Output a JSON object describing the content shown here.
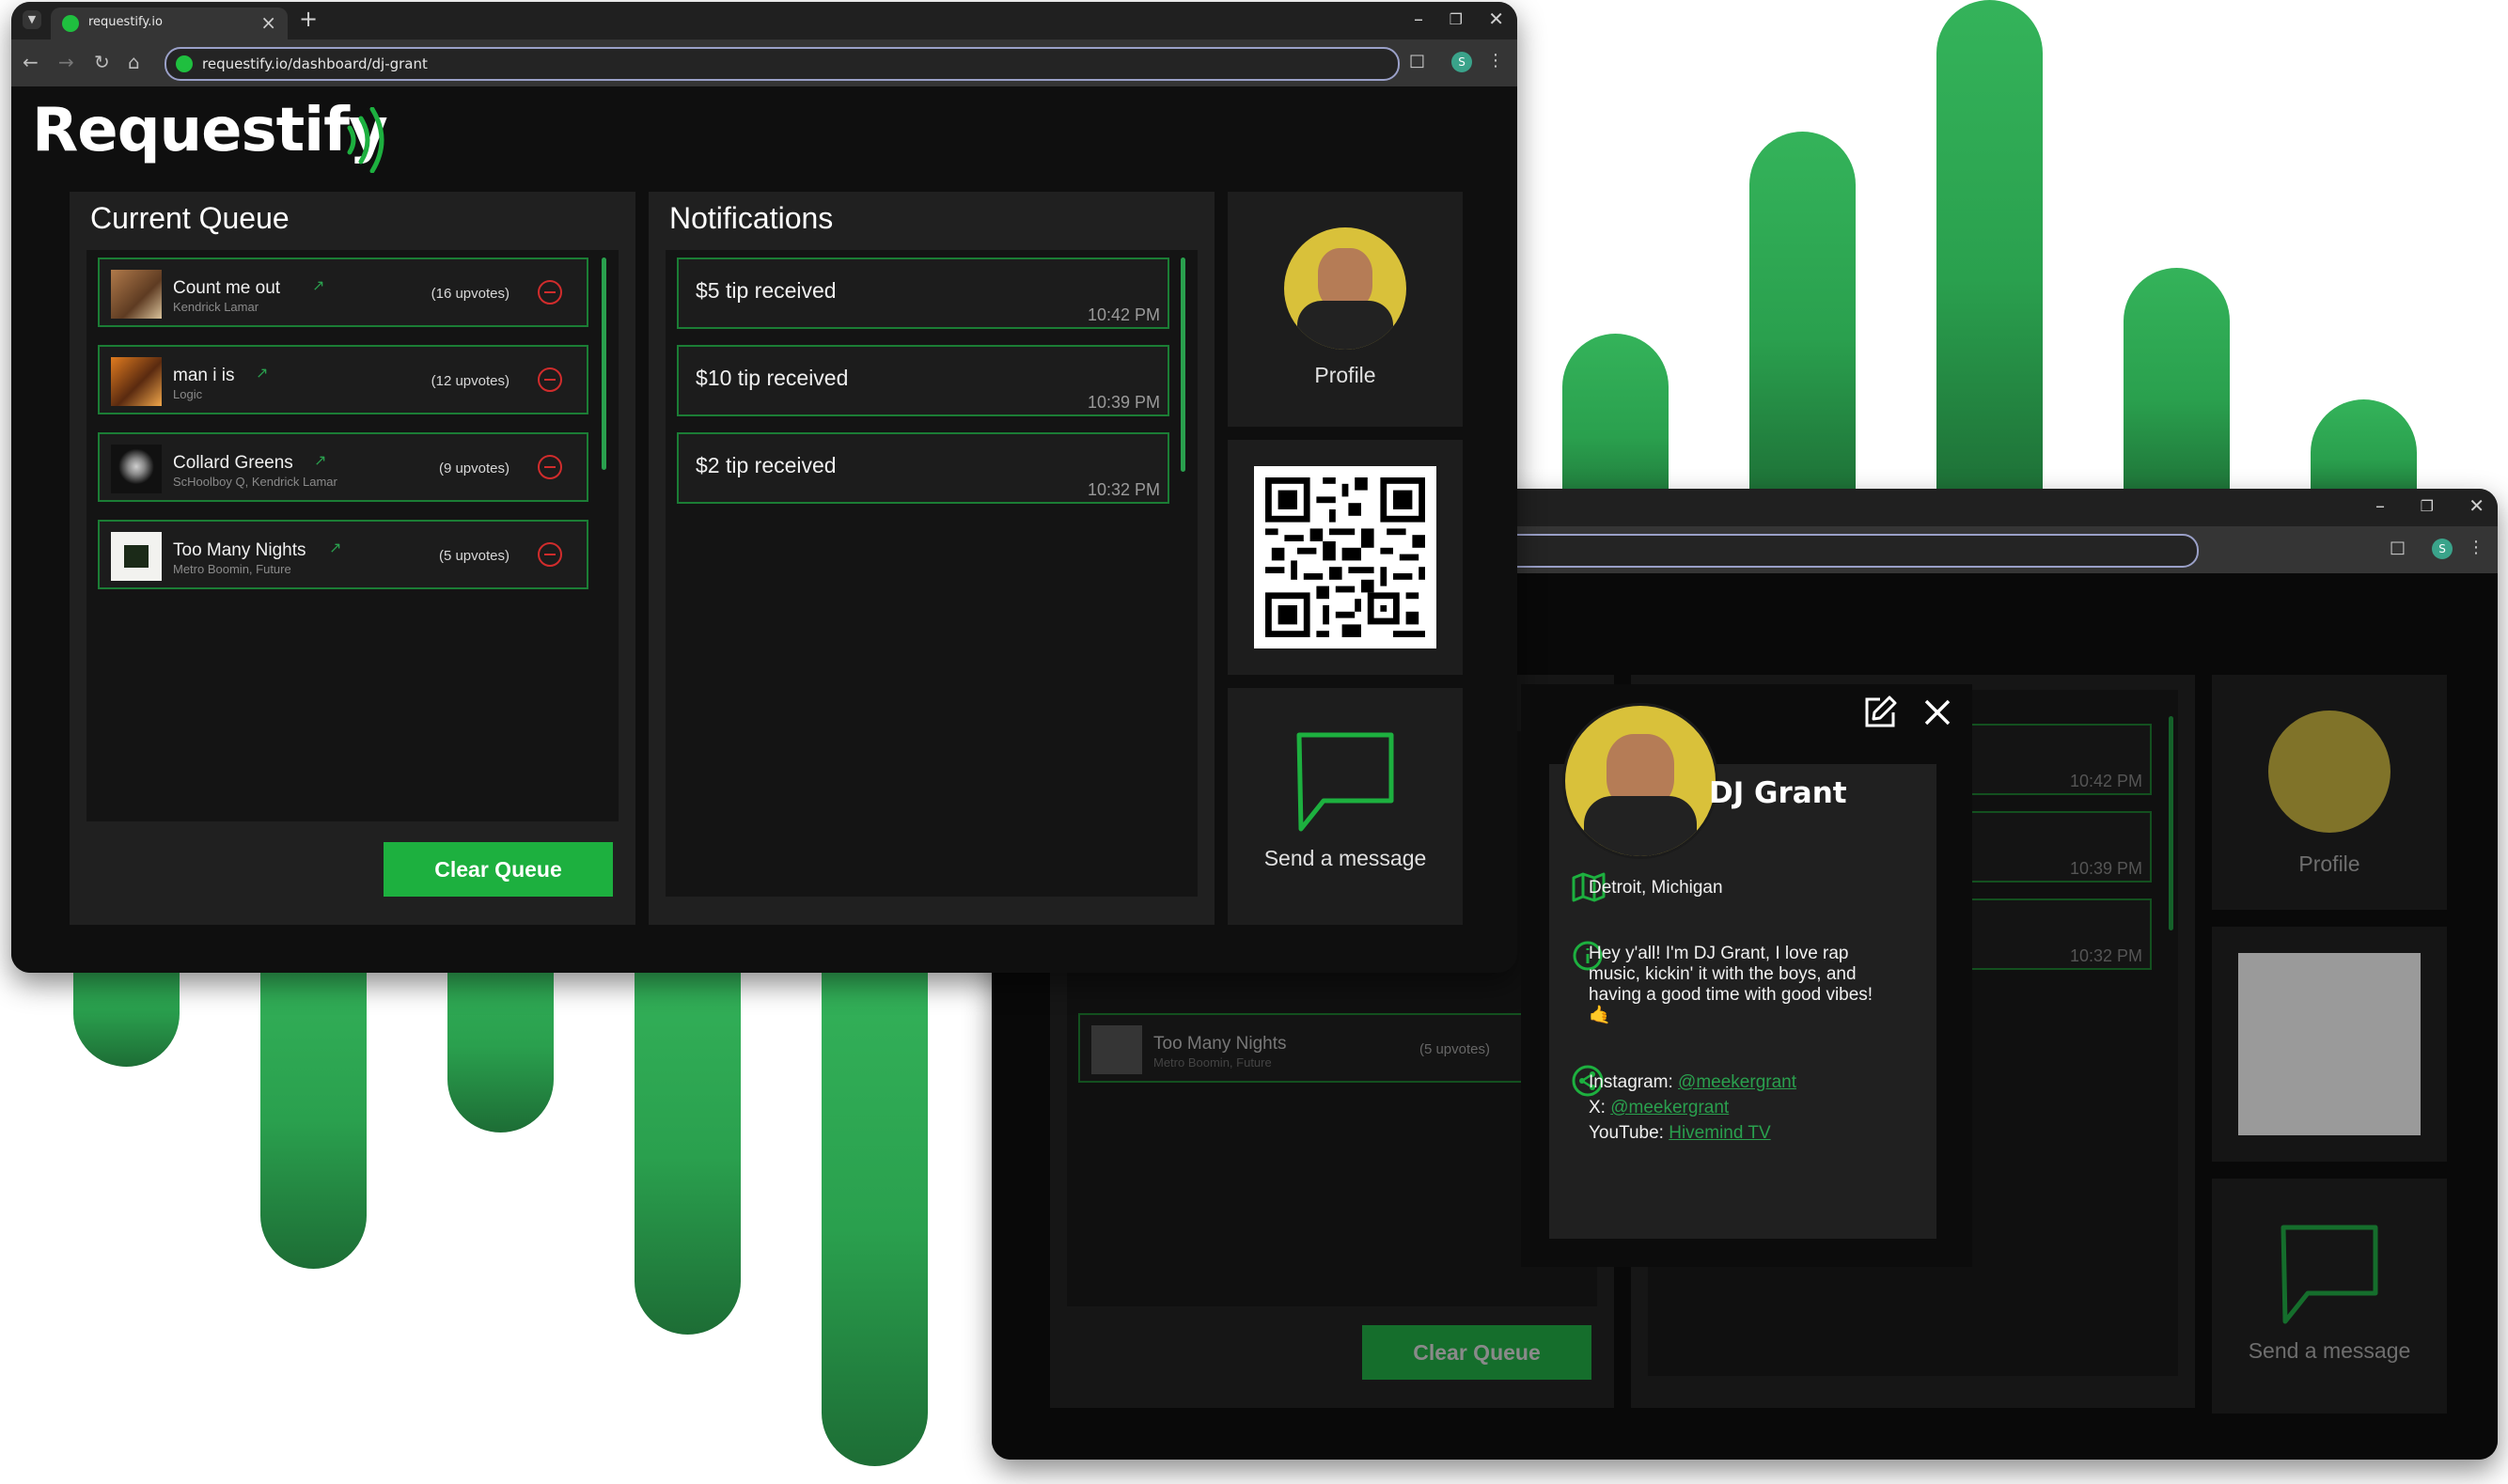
{
  "browser": {
    "tab_title": "requestify.io",
    "url": "requestify.io/dashboard/dj-grant",
    "profile_initial": "S",
    "icons": [
      "tab-menu-icon",
      "close-icon",
      "plus-icon",
      "back-icon",
      "forward-icon",
      "reload-icon",
      "home-icon",
      "extensions-icon",
      "menu-icon",
      "minimize-icon",
      "restore-icon"
    ]
  },
  "app": {
    "logo": "Requestify",
    "brand_green": "#1db03f",
    "danger_red": "#d12c2c"
  },
  "queue": {
    "title": "Current Queue",
    "items": [
      {
        "title": "Count me out",
        "artist": "Kendrick Lamar",
        "votes": "(16 upvotes)"
      },
      {
        "title": "man i is",
        "artist": "Logic",
        "votes": "(12 upvotes)"
      },
      {
        "title": "Collard Greens",
        "artist": "ScHoolboy Q, Kendrick Lamar",
        "votes": "(9 upvotes)"
      },
      {
        "title": "Too Many Nights",
        "artist": "Metro Boomin, Future",
        "votes": "(5 upvotes)"
      }
    ],
    "clear_label": "Clear Queue"
  },
  "notifications": {
    "title": "Notifications",
    "items": [
      {
        "text": "$5 tip received",
        "time": "10:42 PM"
      },
      {
        "text": "$10 tip received",
        "time": "10:39 PM"
      },
      {
        "text": "$2 tip received",
        "time": "10:32 PM"
      }
    ]
  },
  "sidebar": {
    "profile_label": "Profile",
    "message_label": "Send a message"
  },
  "modal": {
    "name": "DJ Grant",
    "location": "Detroit, Michigan",
    "bio": "Hey y'all! I'm DJ Grant, I love rap music, kickin' it with the boys, and having a good time with good vibes!🤙",
    "instagram_label": "Instagram:",
    "instagram_handle": "@meekergrant",
    "x_label": "X:",
    "x_handle": "@meekergrant",
    "youtube_label": "YouTube:",
    "youtube_channel": "Hivemind TV"
  }
}
